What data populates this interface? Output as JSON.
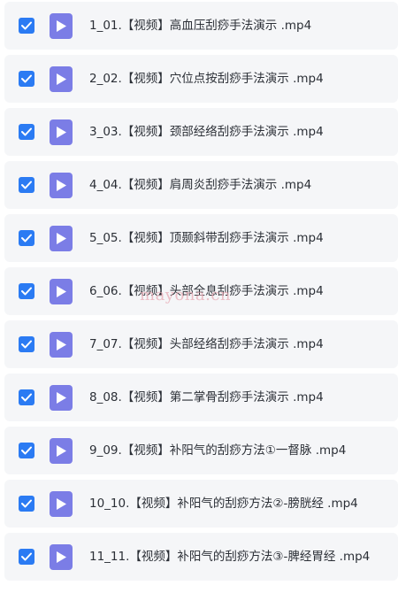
{
  "files": [
    {
      "name": "1_01.【视频】高血压刮痧手法演示 .mp4",
      "checked": true
    },
    {
      "name": "2_02.【视频】穴位点按刮痧手法演示 .mp4",
      "checked": true
    },
    {
      "name": "3_03.【视频】颈部经络刮痧手法演示 .mp4",
      "checked": true
    },
    {
      "name": "4_04.【视频】肩周炎刮痧手法演示 .mp4",
      "checked": true
    },
    {
      "name": "5_05.【视频】顶颞斜带刮痧手法演示 .mp4",
      "checked": true
    },
    {
      "name": "6_06.【视频】头部全息刮痧手法演示 .mp4",
      "checked": true
    },
    {
      "name": "7_07.【视频】头部经络刮痧手法演示 .mp4",
      "checked": true
    },
    {
      "name": "8_08.【视频】第二掌骨刮痧手法演示 .mp4",
      "checked": true
    },
    {
      "name": "9_09.【视频】补阳气的刮痧方法①一督脉 .mp4",
      "checked": true
    },
    {
      "name": "10_10.【视频】补阳气的刮痧方法②-膀胱经 .mp4",
      "checked": true
    },
    {
      "name": "11_11.【视频】补阳气的刮痧方法③-脾经胃经 .mp4",
      "checked": true
    }
  ],
  "watermark": "mayona.cn",
  "colors": {
    "checkbox": "#2b7bf3",
    "file_icon": "#7b7de6",
    "row_bg": "#f5f6f8",
    "text": "#2b2f36"
  }
}
